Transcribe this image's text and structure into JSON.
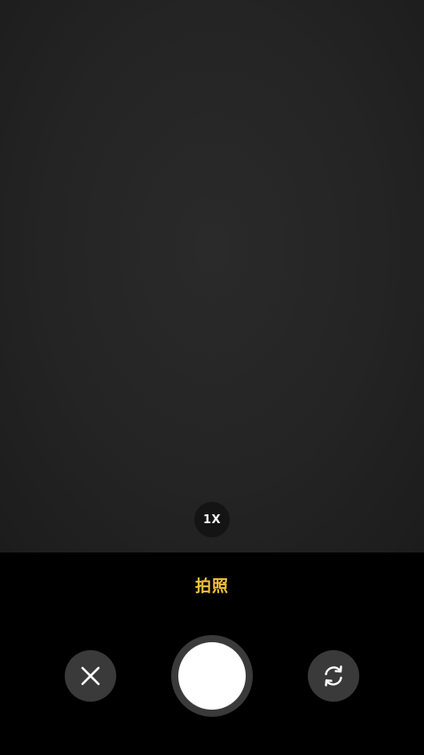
{
  "camera": {
    "zoom_label": "1X",
    "mode_label": "拍照"
  },
  "icons": {
    "close": "close-icon",
    "switch_camera": "switch-camera-icon"
  },
  "colors": {
    "mode_active": "#f2c23a",
    "control_bg": "#3a3a3a",
    "shutter": "#ffffff"
  }
}
